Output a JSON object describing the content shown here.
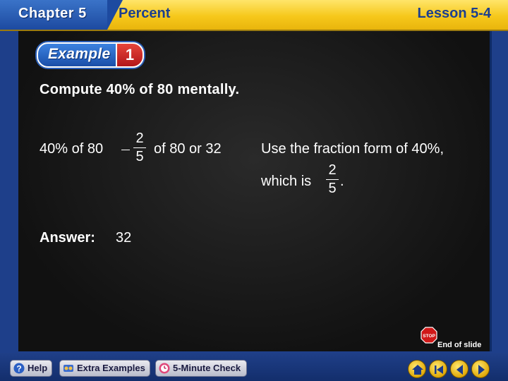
{
  "header": {
    "chapter": "Chapter 5",
    "topic": "Percent",
    "lesson": "Lesson 5-4"
  },
  "example": {
    "word": "Example",
    "number": "1"
  },
  "problem": "Compute 40% of 80 mentally.",
  "work": {
    "lhs": "40% of 80",
    "fraction_numerator": "2",
    "fraction_denominator": "5",
    "rhs": "of 80 or 32"
  },
  "explanation": {
    "line1": "Use the fraction form of 40%,",
    "line2_prefix": "which is",
    "fraction_numerator": "2",
    "fraction_denominator": "5",
    "line2_suffix": "."
  },
  "answer": {
    "label": "Answer:",
    "value": "32"
  },
  "end_of_slide": "End of slide",
  "stop_sign_text": "STOP",
  "footer": {
    "help": "Help",
    "extra_examples": "Extra Examples",
    "five_minute_check": "5-Minute Check"
  },
  "colors": {
    "header_yellow": "#f6c81b",
    "header_blue": "#1c3f8f",
    "board": "#1a1a1a",
    "footer_blue": "#1f3f88",
    "badge_blue": "#2a5fb9",
    "badge_red": "#c8201f",
    "nav_gold": "#e0a90a"
  },
  "icons": [
    "question-icon",
    "examples-icon",
    "clock-icon",
    "home-icon",
    "first-slide-icon",
    "previous-icon",
    "next-icon",
    "stop-sign-icon"
  ]
}
